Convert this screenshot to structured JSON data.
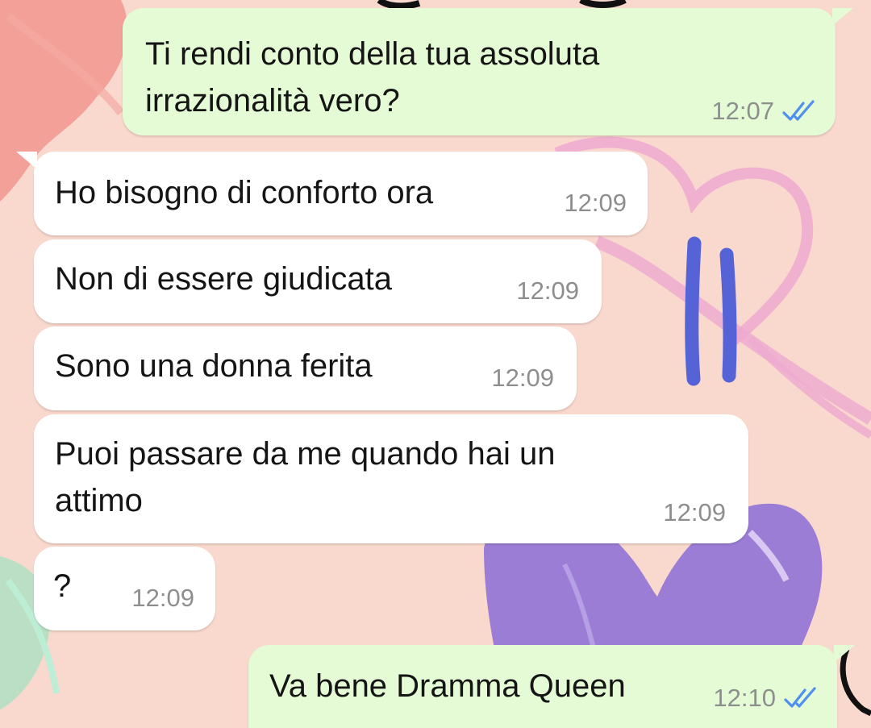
{
  "theme": {
    "incoming_bubble": "#ffffff",
    "outgoing_bubble": "#e4fbd6",
    "time_color": "#8d8f8d",
    "read_tick_color": "#4f8ff0",
    "wallpaper_base": "#f9d8cd",
    "annotation_color": "#5563d6"
  },
  "messages": [
    {
      "direction": "outgoing",
      "text": "Ti rendi conto della tua assoluta\nirrazionalità vero?",
      "time": "12:07",
      "status_icon": "double-check-read-icon"
    },
    {
      "direction": "incoming",
      "text": "Ho bisogno di conforto ora",
      "time": "12:09"
    },
    {
      "direction": "incoming",
      "text": "Non di essere giudicata",
      "time": "12:09"
    },
    {
      "direction": "incoming",
      "text": "Sono una donna ferita",
      "time": "12:09"
    },
    {
      "direction": "incoming",
      "text": "Puoi passare da me quando hai un\nattimo",
      "time": "12:09"
    },
    {
      "direction": "incoming",
      "text": "?",
      "time": "12:09"
    },
    {
      "direction": "outgoing",
      "text": "Va bene Dramma Queen",
      "time": "12:10",
      "status_icon": "double-check-read-icon"
    }
  ]
}
